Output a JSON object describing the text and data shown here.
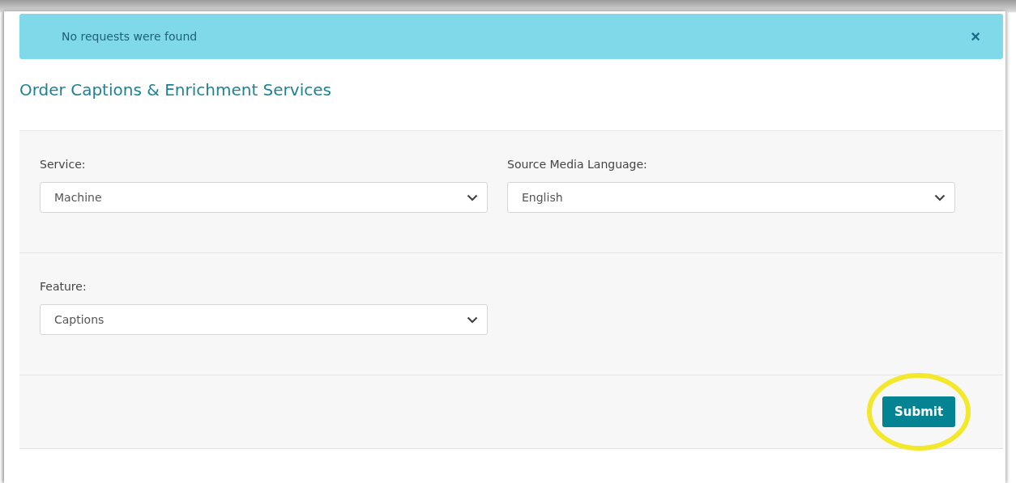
{
  "alert": {
    "message": "No requests were found",
    "close": "×"
  },
  "title": "Order Captions & Enrichment Services",
  "form_rows": [
    {
      "fields": [
        {
          "label": "Service:",
          "value": "Machine"
        },
        {
          "label": "Source Media Language:",
          "value": "English"
        }
      ]
    },
    {
      "fields": [
        {
          "label": "Feature:",
          "value": "Captions"
        }
      ]
    }
  ],
  "submit": {
    "label": "Submit",
    "highlighted": true
  }
}
